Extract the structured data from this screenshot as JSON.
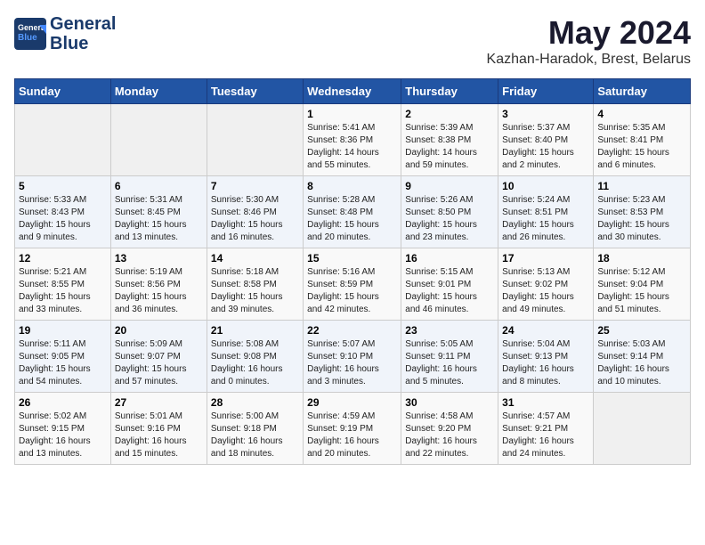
{
  "header": {
    "title": "May 2024",
    "subtitle": "Kazhan-Haradok, Brest, Belarus",
    "logo_line1": "General",
    "logo_line2": "Blue"
  },
  "weekdays": [
    "Sunday",
    "Monday",
    "Tuesday",
    "Wednesday",
    "Thursday",
    "Friday",
    "Saturday"
  ],
  "weeks": [
    [
      {
        "day": "",
        "info": ""
      },
      {
        "day": "",
        "info": ""
      },
      {
        "day": "",
        "info": ""
      },
      {
        "day": "1",
        "info": "Sunrise: 5:41 AM\nSunset: 8:36 PM\nDaylight: 14 hours\nand 55 minutes."
      },
      {
        "day": "2",
        "info": "Sunrise: 5:39 AM\nSunset: 8:38 PM\nDaylight: 14 hours\nand 59 minutes."
      },
      {
        "day": "3",
        "info": "Sunrise: 5:37 AM\nSunset: 8:40 PM\nDaylight: 15 hours\nand 2 minutes."
      },
      {
        "day": "4",
        "info": "Sunrise: 5:35 AM\nSunset: 8:41 PM\nDaylight: 15 hours\nand 6 minutes."
      }
    ],
    [
      {
        "day": "5",
        "info": "Sunrise: 5:33 AM\nSunset: 8:43 PM\nDaylight: 15 hours\nand 9 minutes."
      },
      {
        "day": "6",
        "info": "Sunrise: 5:31 AM\nSunset: 8:45 PM\nDaylight: 15 hours\nand 13 minutes."
      },
      {
        "day": "7",
        "info": "Sunrise: 5:30 AM\nSunset: 8:46 PM\nDaylight: 15 hours\nand 16 minutes."
      },
      {
        "day": "8",
        "info": "Sunrise: 5:28 AM\nSunset: 8:48 PM\nDaylight: 15 hours\nand 20 minutes."
      },
      {
        "day": "9",
        "info": "Sunrise: 5:26 AM\nSunset: 8:50 PM\nDaylight: 15 hours\nand 23 minutes."
      },
      {
        "day": "10",
        "info": "Sunrise: 5:24 AM\nSunset: 8:51 PM\nDaylight: 15 hours\nand 26 minutes."
      },
      {
        "day": "11",
        "info": "Sunrise: 5:23 AM\nSunset: 8:53 PM\nDaylight: 15 hours\nand 30 minutes."
      }
    ],
    [
      {
        "day": "12",
        "info": "Sunrise: 5:21 AM\nSunset: 8:55 PM\nDaylight: 15 hours\nand 33 minutes."
      },
      {
        "day": "13",
        "info": "Sunrise: 5:19 AM\nSunset: 8:56 PM\nDaylight: 15 hours\nand 36 minutes."
      },
      {
        "day": "14",
        "info": "Sunrise: 5:18 AM\nSunset: 8:58 PM\nDaylight: 15 hours\nand 39 minutes."
      },
      {
        "day": "15",
        "info": "Sunrise: 5:16 AM\nSunset: 8:59 PM\nDaylight: 15 hours\nand 42 minutes."
      },
      {
        "day": "16",
        "info": "Sunrise: 5:15 AM\nSunset: 9:01 PM\nDaylight: 15 hours\nand 46 minutes."
      },
      {
        "day": "17",
        "info": "Sunrise: 5:13 AM\nSunset: 9:02 PM\nDaylight: 15 hours\nand 49 minutes."
      },
      {
        "day": "18",
        "info": "Sunrise: 5:12 AM\nSunset: 9:04 PM\nDaylight: 15 hours\nand 51 minutes."
      }
    ],
    [
      {
        "day": "19",
        "info": "Sunrise: 5:11 AM\nSunset: 9:05 PM\nDaylight: 15 hours\nand 54 minutes."
      },
      {
        "day": "20",
        "info": "Sunrise: 5:09 AM\nSunset: 9:07 PM\nDaylight: 15 hours\nand 57 minutes."
      },
      {
        "day": "21",
        "info": "Sunrise: 5:08 AM\nSunset: 9:08 PM\nDaylight: 16 hours\nand 0 minutes."
      },
      {
        "day": "22",
        "info": "Sunrise: 5:07 AM\nSunset: 9:10 PM\nDaylight: 16 hours\nand 3 minutes."
      },
      {
        "day": "23",
        "info": "Sunrise: 5:05 AM\nSunset: 9:11 PM\nDaylight: 16 hours\nand 5 minutes."
      },
      {
        "day": "24",
        "info": "Sunrise: 5:04 AM\nSunset: 9:13 PM\nDaylight: 16 hours\nand 8 minutes."
      },
      {
        "day": "25",
        "info": "Sunrise: 5:03 AM\nSunset: 9:14 PM\nDaylight: 16 hours\nand 10 minutes."
      }
    ],
    [
      {
        "day": "26",
        "info": "Sunrise: 5:02 AM\nSunset: 9:15 PM\nDaylight: 16 hours\nand 13 minutes."
      },
      {
        "day": "27",
        "info": "Sunrise: 5:01 AM\nSunset: 9:16 PM\nDaylight: 16 hours\nand 15 minutes."
      },
      {
        "day": "28",
        "info": "Sunrise: 5:00 AM\nSunset: 9:18 PM\nDaylight: 16 hours\nand 18 minutes."
      },
      {
        "day": "29",
        "info": "Sunrise: 4:59 AM\nSunset: 9:19 PM\nDaylight: 16 hours\nand 20 minutes."
      },
      {
        "day": "30",
        "info": "Sunrise: 4:58 AM\nSunset: 9:20 PM\nDaylight: 16 hours\nand 22 minutes."
      },
      {
        "day": "31",
        "info": "Sunrise: 4:57 AM\nSunset: 9:21 PM\nDaylight: 16 hours\nand 24 minutes."
      },
      {
        "day": "",
        "info": ""
      }
    ]
  ]
}
